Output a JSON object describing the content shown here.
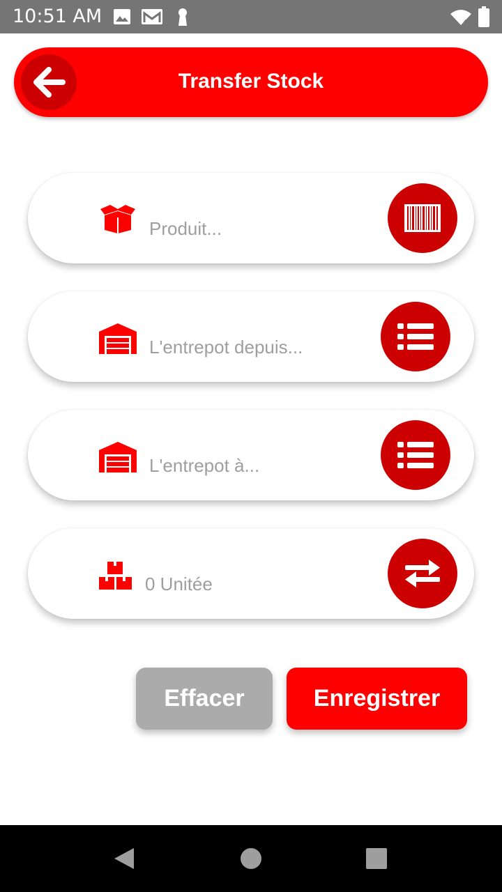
{
  "status_bar": {
    "time": "10:51 AM",
    "left_icons": [
      "image-icon",
      "gmail-icon",
      "keyhole-icon"
    ],
    "right_icons": [
      "wifi-icon",
      "battery-icon"
    ]
  },
  "header": {
    "title": "Transfer Stock",
    "back_icon": "arrow-left-icon",
    "color": "#ff0000"
  },
  "form": {
    "product": {
      "placeholder": "Produit...",
      "value": "",
      "icon": "box-icon",
      "action_icon": "barcode-icon"
    },
    "warehouse_from": {
      "placeholder": "L'entrepot depuis...",
      "value": "",
      "icon": "warehouse-icon",
      "action_icon": "list-icon"
    },
    "warehouse_to": {
      "placeholder": "L'entrepot à...",
      "value": "",
      "icon": "warehouse-icon",
      "action_icon": "list-icon"
    },
    "quantity": {
      "placeholder": "0 Unitée",
      "value": "",
      "icon": "boxes-icon",
      "action_icon": "transfer-icon"
    }
  },
  "actions": {
    "clear_label": "Effacer",
    "save_label": "Enregistrer"
  },
  "colors": {
    "primary": "#ff0000",
    "primary_dark": "#cc0000",
    "clear": "#ababab",
    "placeholder": "#9e9e9e"
  },
  "nav_bar": {
    "buttons": [
      "back-triangle-icon",
      "home-circle-icon",
      "recents-square-icon"
    ]
  }
}
